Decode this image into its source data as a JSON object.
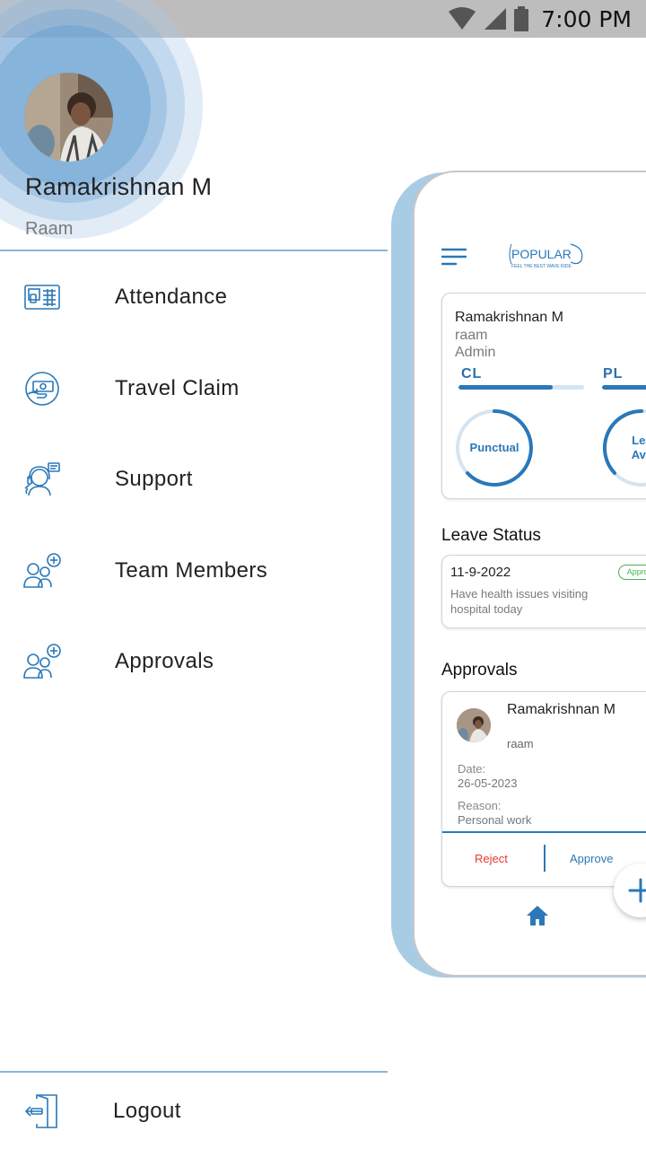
{
  "status_bar": {
    "time": "7:00 PM"
  },
  "drawer": {
    "user_name": "Ramakrishnan M",
    "user_handle": "Raam",
    "menu": [
      {
        "label": "Attendance",
        "icon": "attendance-icon"
      },
      {
        "label": "Travel Claim",
        "icon": "travel-claim-icon"
      },
      {
        "label": "Support",
        "icon": "support-icon"
      },
      {
        "label": "Team Members",
        "icon": "team-members-icon"
      },
      {
        "label": "Approvals",
        "icon": "approvals-icon"
      }
    ],
    "logout_label": "Logout"
  },
  "preview": {
    "logo_text": "POPULAR",
    "logo_tagline": "FEEL THE BEST WAVE RIDE",
    "profile": {
      "name": "Ramakrishnan M",
      "handle": "raam",
      "role": "Admin",
      "leave_types": [
        {
          "label": "CL",
          "fill": 0.75
        },
        {
          "label": "PL",
          "fill": 0.9
        }
      ],
      "rings": [
        {
          "label": "Punctual"
        },
        {
          "label_line1": "Leav",
          "label_line2": "Avail"
        }
      ]
    },
    "leave_status": {
      "title": "Leave Status",
      "date": "11-9-2022",
      "badge": "Approved",
      "description": "Have health issues visiting hospital today"
    },
    "approvals": {
      "title": "Approvals",
      "name": "Ramakrishnan M",
      "handle": "raam",
      "date_label": "Date:",
      "date_value": "26-05-2023",
      "reason_label": "Reason:",
      "reason_value": "Personal work",
      "reject_label": "Reject",
      "approve_label": "Approve"
    }
  },
  "colors": {
    "accent": "#2a78b8",
    "divider": "#8ab6d8",
    "reject": "#e53935",
    "approved": "#4caf50"
  }
}
